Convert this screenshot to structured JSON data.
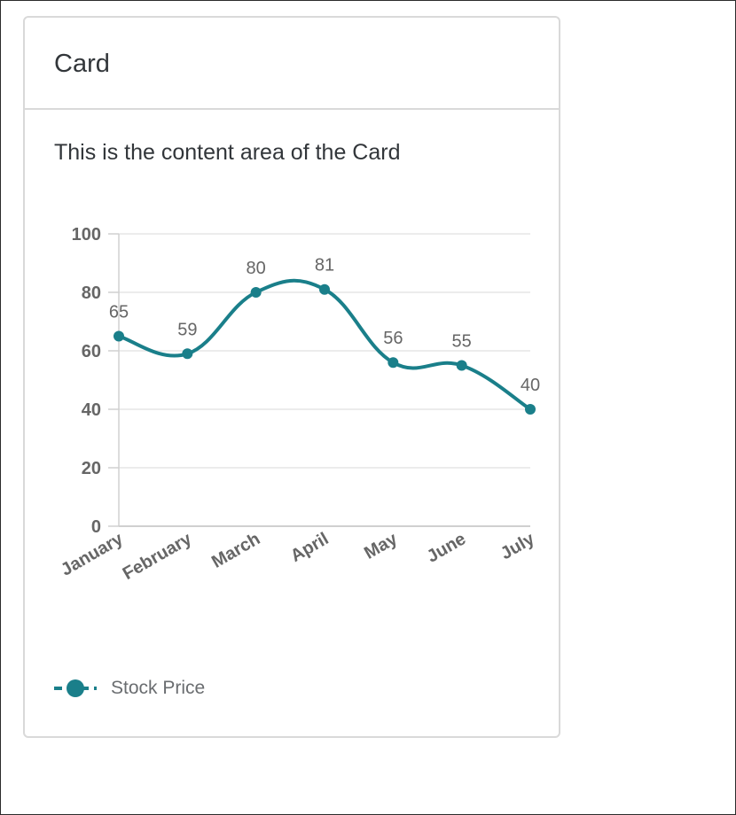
{
  "card": {
    "title": "Card",
    "content_text": "This is the content area of the Card"
  },
  "colors": {
    "series": "#1a7f8a",
    "grid": "#e5e5e5",
    "axis": "#d0d0d0",
    "tick_label": "#666666",
    "data_label": "#666666"
  },
  "legend": {
    "position": "bottom-left",
    "items": [
      {
        "label": "Stock Price",
        "icon": "line-with-dot-marker"
      }
    ]
  },
  "chart_data": {
    "type": "line",
    "smooth": true,
    "categories": [
      "January",
      "February",
      "March",
      "April",
      "May",
      "June",
      "July"
    ],
    "series": [
      {
        "name": "Stock Price",
        "values": [
          65,
          59,
          80,
          81,
          56,
          55,
          40
        ]
      }
    ],
    "ylim": [
      0,
      100
    ],
    "yticks": [
      0,
      20,
      40,
      60,
      80,
      100
    ],
    "grid": true,
    "data_labels": true,
    "xlabel": "",
    "ylabel": ""
  }
}
